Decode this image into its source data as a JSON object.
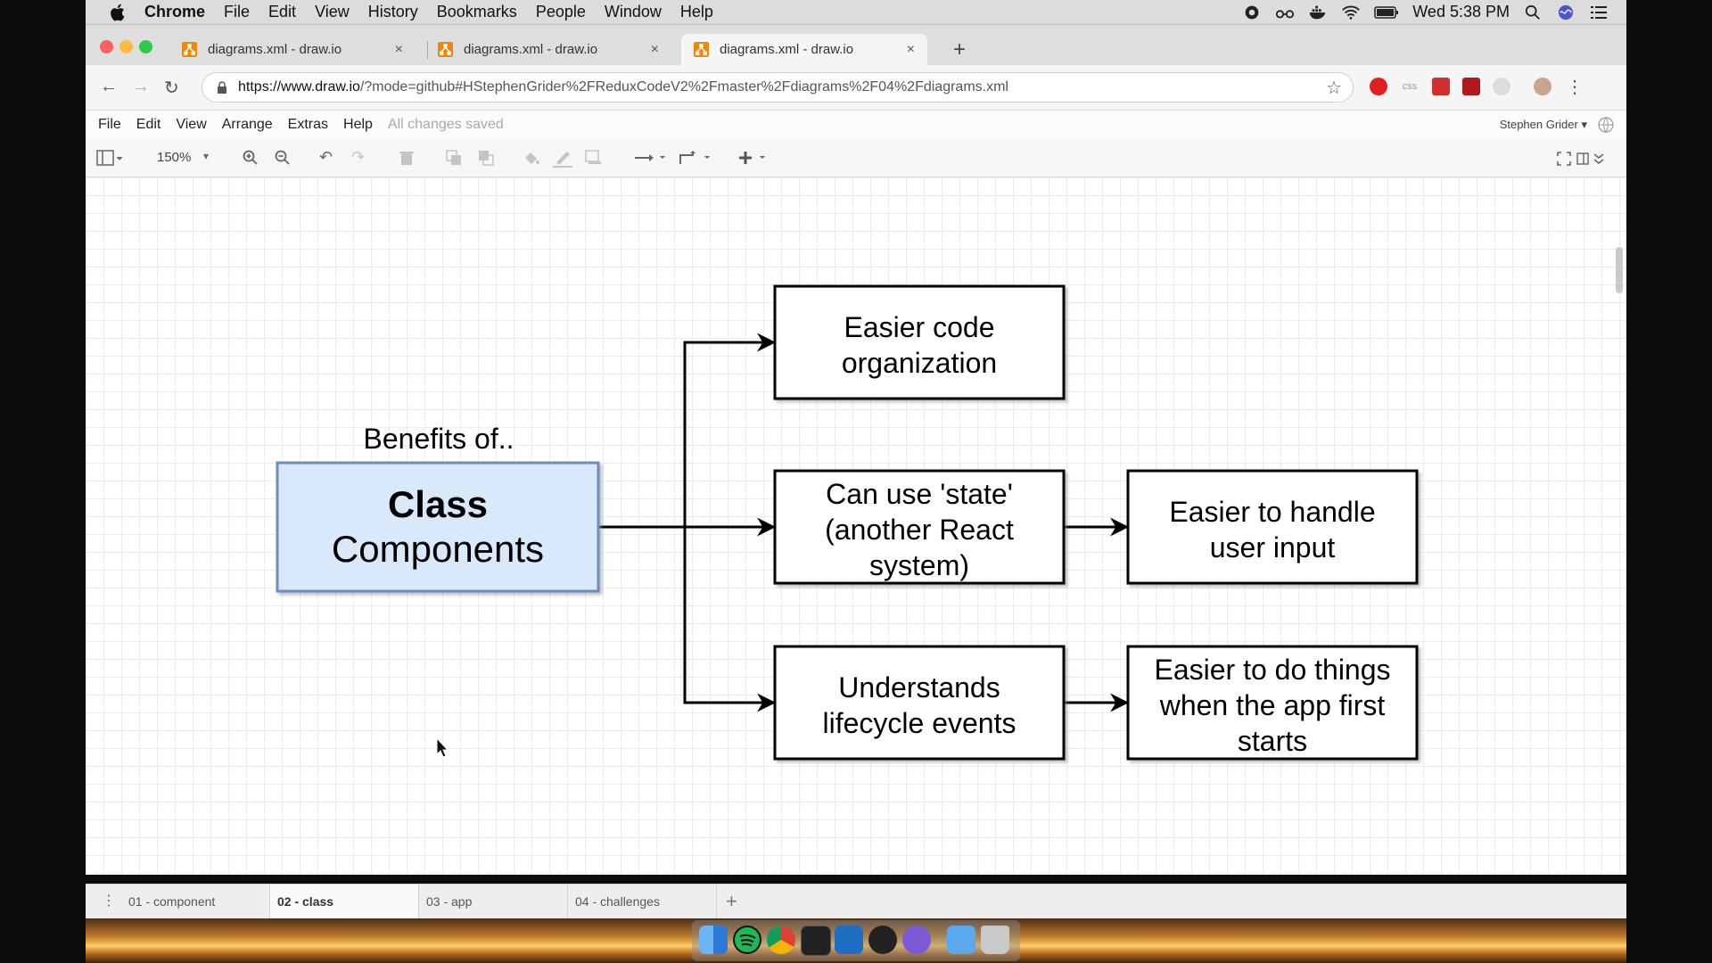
{
  "menubar": {
    "app_name": "Chrome",
    "items": [
      "File",
      "Edit",
      "View",
      "History",
      "Bookmarks",
      "People",
      "Window",
      "Help"
    ],
    "clock": "Wed 5:38 PM"
  },
  "tabs": [
    {
      "title": "diagrams.xml - draw.io",
      "close": "×"
    },
    {
      "title": "diagrams.xml - draw.io",
      "close": "×"
    },
    {
      "title": "diagrams.xml - draw.io",
      "close": "×"
    }
  ],
  "new_tab": "+",
  "address": {
    "host": "https://www.draw.io",
    "rest": "/?mode=github#HStephenGrider%2FReduxCodeV2%2Fmaster%2Fdiagrams%2F04%2Fdiagrams.xml"
  },
  "app_menu": {
    "items": [
      "File",
      "Edit",
      "View",
      "Arrange",
      "Extras",
      "Help"
    ],
    "status": "All changes saved",
    "user": "Stephen Grider ▾"
  },
  "toolbar": {
    "zoom": "150%"
  },
  "diagram": {
    "caption": "Benefits of..",
    "main": {
      "line1": "Class",
      "line2": "Components"
    },
    "boxes": [
      {
        "lines": [
          "Easier code",
          "organization"
        ]
      },
      {
        "lines": [
          "Can use 'state'",
          "(another React",
          "system)"
        ]
      },
      {
        "lines": [
          "Understands",
          "lifecycle events"
        ]
      },
      {
        "lines": [
          "Easier to handle",
          "user input"
        ]
      },
      {
        "lines": [
          "Easier to do things",
          "when the app first",
          "starts"
        ]
      }
    ]
  },
  "page_tabs": [
    "01 - component",
    "02 - class",
    "03 - app",
    "04 - challenges"
  ],
  "page_add": "+",
  "colors": {
    "main_fill": "#dae8fc",
    "main_stroke": "#6c8ebf",
    "close_red": "#fc605c",
    "min_yellow": "#fdbc40",
    "max_green": "#34c84a",
    "drawio_orange": "#f08705"
  }
}
